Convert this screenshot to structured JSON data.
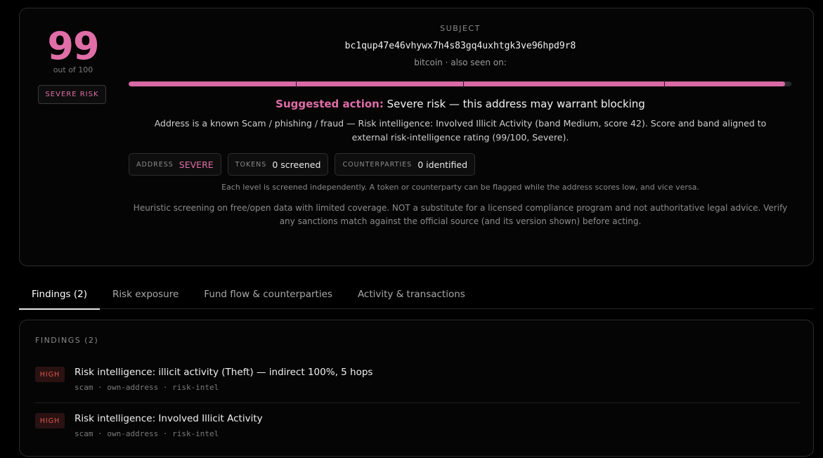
{
  "summary": {
    "score": "99",
    "score_of": "out of 100",
    "risk_badge": "SEVERE RISK",
    "score_fraction": 0.99,
    "subject_label": "SUBJECT",
    "address": "bc1qup47e46vhywx7h4s83gq4uxhtgk3ve96hpd9r8",
    "chain_line": "bitcoin · also seen on:",
    "suggested_label": "Suggested action:",
    "suggested_text": "Severe risk — this address may warrant blocking",
    "description": "Address is a known Scam / phishing / fraud — Risk intelligence: Involved Illicit Activity (band Medium, score 42). Score and band aligned to external risk-intelligence rating (99/100, Severe).",
    "chips": [
      {
        "key": "ADDRESS",
        "value": "SEVERE"
      },
      {
        "key": "TOKENS",
        "value": "0 screened"
      },
      {
        "key": "COUNTERPARTIES",
        "value": "0 identified"
      }
    ],
    "note_levels": "Each level is screened independently. A token or counterparty can be flagged while the address scores low, and vice versa.",
    "disclaimer": "Heuristic screening on free/open data with limited coverage. NOT a substitute for a licensed compliance program and not authoritative legal advice. Verify any sanctions match against the official source (and its version shown) before acting."
  },
  "tabs": [
    {
      "label": "Findings (2)",
      "active": true
    },
    {
      "label": "Risk exposure"
    },
    {
      "label": "Fund flow & counterparties"
    },
    {
      "label": "Activity & transactions"
    }
  ],
  "findings": {
    "title": "FINDINGS (2)",
    "items": [
      {
        "severity": "HIGH",
        "title": "Risk intelligence: illicit activity (Theft) — indirect 100%, 5 hops",
        "tags": "scam · own-address · risk-intel"
      },
      {
        "severity": "HIGH",
        "title": "Risk intelligence: Involved Illicit Activity",
        "tags": "scam · own-address · risk-intel"
      }
    ]
  },
  "colors": {
    "accent": "#e06ea7",
    "high": "#e0584e"
  }
}
